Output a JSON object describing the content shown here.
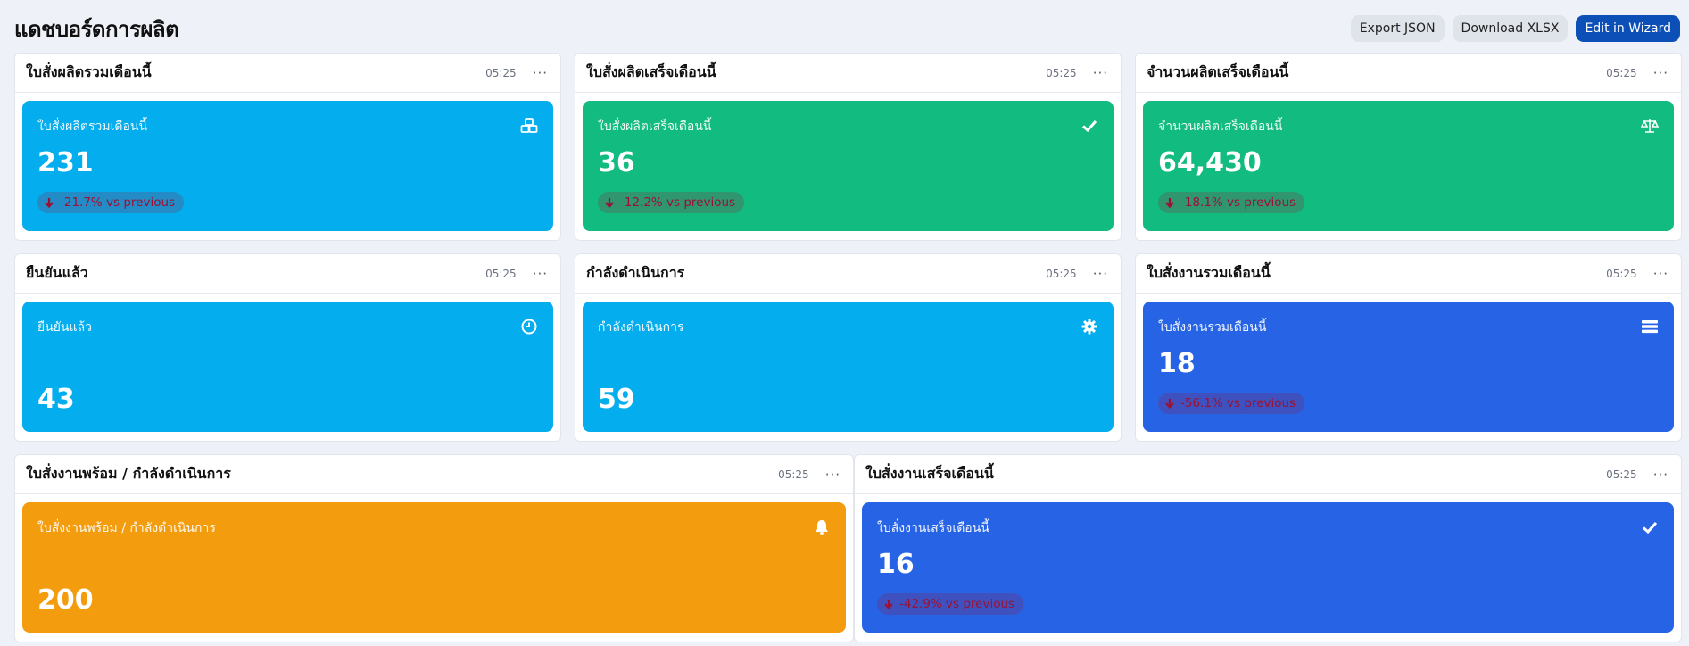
{
  "header": {
    "title": "แดชบอร์ดการผลิต",
    "actions": {
      "export_json": "Export JSON",
      "download_xlsx": "Download XLSX",
      "edit_wizard": "Edit in Wizard"
    }
  },
  "widgets": [
    {
      "title": "ใบสั่งผลิตรวมเดือนนี้",
      "time": "05:25",
      "more": "···",
      "label": "ใบสั่งผลิตรวมเดือนนี้",
      "value": "231",
      "trend": "-21.7% vs previous",
      "icon": "cubes-icon",
      "color": "#03adee"
    },
    {
      "title": "ใบสั่งผลิตเสร็จเดือนนี้",
      "time": "05:25",
      "more": "···",
      "label": "ใบสั่งผลิตเสร็จเดือนนี้",
      "value": "36",
      "trend": "-12.2% vs previous",
      "icon": "check-icon",
      "color": "#12bb7f"
    },
    {
      "title": "จำนวนผลิตเสร็จเดือนนี้",
      "time": "05:25",
      "more": "···",
      "label": "จำนวนผลิตเสร็จเดือนนี้",
      "value": "64,430",
      "trend": "-18.1% vs previous",
      "icon": "balance-scale-icon",
      "color": "#12bb7f"
    },
    {
      "title": "ยืนยันแล้ว",
      "time": "05:25",
      "more": "···",
      "label": "ยืนยันแล้ว",
      "value": "43",
      "icon": "clock-icon",
      "color": "#03adee"
    },
    {
      "title": "กำลังดำเนินการ",
      "time": "05:25",
      "more": "···",
      "label": "กำลังดำเนินการ",
      "value": "59",
      "icon": "gear-icon",
      "color": "#03adee"
    },
    {
      "title": "ใบสั่งงานรวมเดือนนี้",
      "time": "05:25",
      "more": "···",
      "label": "ใบสั่งงานรวมเดือนนี้",
      "value": "18",
      "trend": "-56.1% vs previous",
      "icon": "list-icon",
      "color": "#2763e5"
    },
    {
      "title": "ใบสั่งงานพร้อม / กำลังดำเนินการ",
      "time": "05:25",
      "more": "···",
      "label": "ใบสั่งงานพร้อม / กำลังดำเนินการ",
      "value": "200",
      "icon": "bell-icon",
      "color": "#f39c0e"
    },
    {
      "title": "ใบสั่งงานเสร็จเดือนนี้",
      "time": "05:25",
      "more": "···",
      "label": "ใบสั่งงานเสร็จเดือนนี้",
      "value": "16",
      "trend": "-42.9% vs previous",
      "icon": "check-icon",
      "color": "#2763e5"
    }
  ]
}
